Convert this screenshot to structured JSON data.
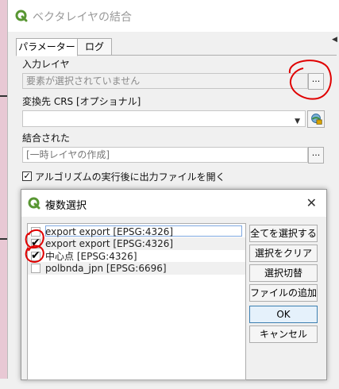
{
  "window": {
    "title": "ベクタレイヤの結合"
  },
  "tabs": [
    {
      "label": "パラメーター",
      "active": true
    },
    {
      "label": "ログ",
      "active": false
    }
  ],
  "params": {
    "input_layer_label": "入力レイヤ",
    "input_layer_value": "要素が選択されていません",
    "input_layer_button": "...",
    "crs_label": "変換先 CRS [オプショナル]",
    "crs_value": "",
    "output_label": "結合された",
    "output_value": "[一時レイヤの作成]",
    "output_button": "...",
    "open_after_label": "アルゴリズムの実行後に出力ファイルを開く",
    "open_after_checked": true
  },
  "dialog": {
    "title": "複数選択",
    "close": "✕",
    "items": [
      {
        "label": "export export [EPSG:4326]",
        "checked": false,
        "focused": true
      },
      {
        "label": "export export [EPSG:4326]",
        "checked": true
      },
      {
        "label": "中心点 [EPSG:4326]",
        "checked": true
      },
      {
        "label": "polbnda_jpn [EPSG:6696]",
        "checked": false
      }
    ],
    "buttons": {
      "select_all": "全てを選択する",
      "clear": "選択をクリア",
      "toggle": "選択切替",
      "add_file": "ファイルの追加...",
      "ok": "OK",
      "cancel": "キャンセル"
    }
  },
  "colors": {
    "qgis_green": "#589632",
    "annotation_red": "#e00000",
    "focus_blue": "#7fa8e0"
  }
}
